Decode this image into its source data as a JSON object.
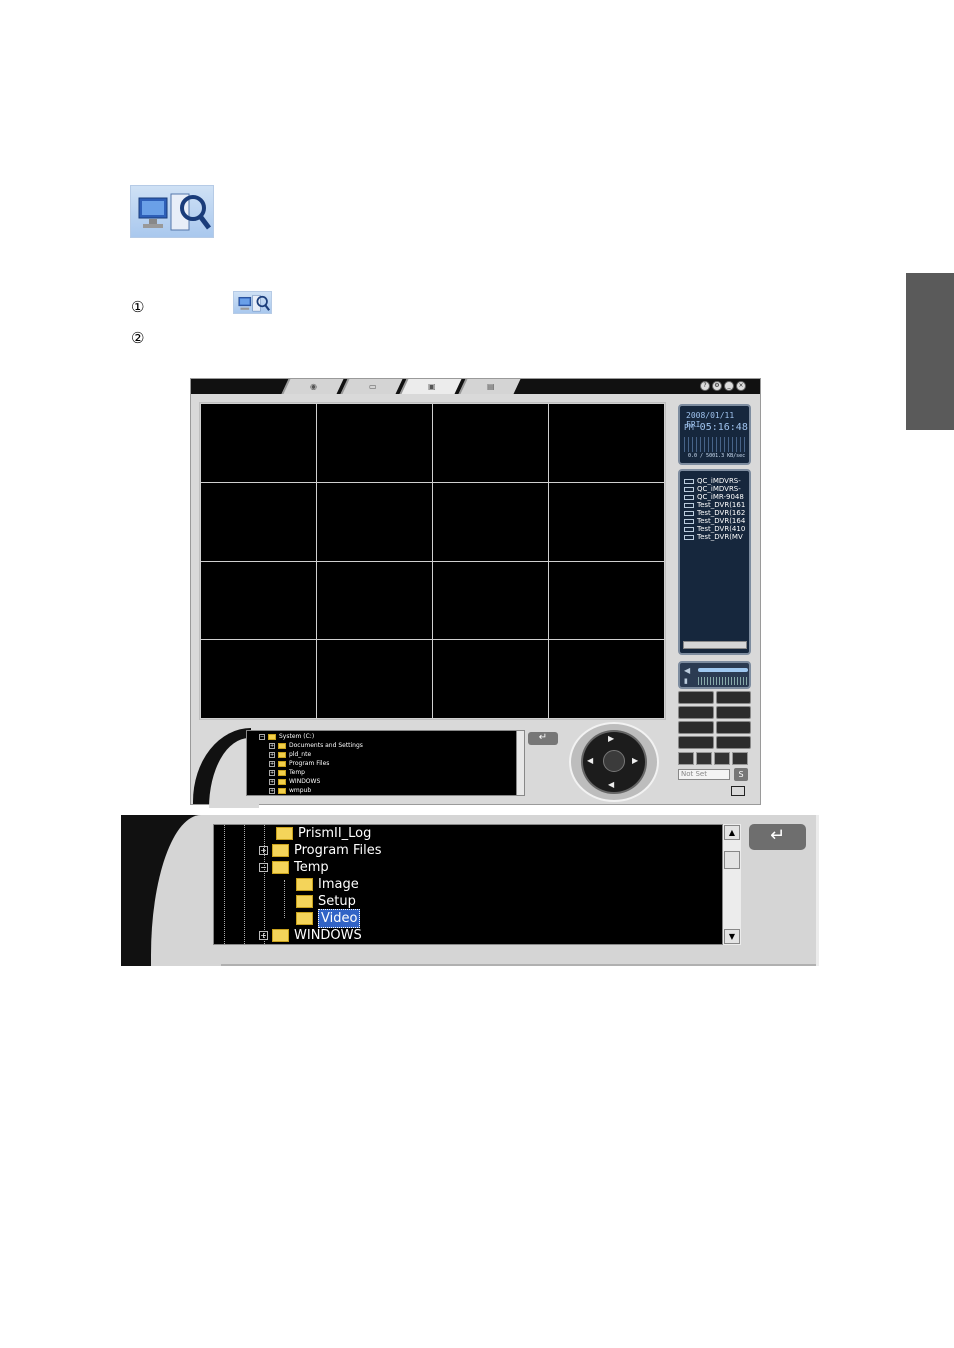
{
  "page": {
    "step_marks": [
      "①",
      "②"
    ]
  },
  "app": {
    "tabs": [
      {
        "name": "live-view-tab",
        "icon": "camera-icon"
      },
      {
        "name": "setup-tab",
        "icon": "keyboard-icon"
      },
      {
        "name": "search-tab",
        "icon": "monitor-search-icon",
        "active": true
      },
      {
        "name": "backup-tab",
        "icon": "recorder-icon"
      }
    ],
    "window_buttons": [
      "?",
      "⚙",
      "_",
      "×"
    ],
    "clock": {
      "date": "2008/01/11 FRI",
      "ampm": "PM",
      "time": "05:16:48",
      "rate": "0.0 / 5001.3 KB/sec"
    },
    "dvr_list": [
      "QC_iMDVRS-",
      "QC_iMDVRS-",
      "QC_iMR-9048",
      "Test_DVR(161",
      "Test_DVR(162",
      "Test_DVR(164",
      "Test_DVR(410",
      "Test_DVR(MV"
    ],
    "not_set_label": "Not Set",
    "s_button": "S",
    "enter_symbol": "↵",
    "small_tree": [
      {
        "label": "System (C:)",
        "level": 0,
        "expander": "−"
      },
      {
        "label": "Documents and Settings",
        "level": 1,
        "expander": "+"
      },
      {
        "label": "pld_nte",
        "level": 1,
        "expander": "+"
      },
      {
        "label": "Program Files",
        "level": 1,
        "expander": "+"
      },
      {
        "label": "Temp",
        "level": 1,
        "expander": "+"
      },
      {
        "label": "WINDOWS",
        "level": 1,
        "expander": "+"
      },
      {
        "label": "wmpub",
        "level": 1,
        "expander": "+"
      }
    ]
  },
  "zoom_tree": {
    "items": [
      {
        "label": "PrismII_Log",
        "level": 0,
        "expander": ""
      },
      {
        "label": "Program Files",
        "level": 0,
        "expander": "+"
      },
      {
        "label": "Temp",
        "level": 0,
        "expander": "−"
      },
      {
        "label": "Image",
        "level": 1,
        "expander": ""
      },
      {
        "label": "Setup",
        "level": 1,
        "expander": ""
      },
      {
        "label": "Video",
        "level": 1,
        "expander": "",
        "selected": true
      },
      {
        "label": "WINDOWS",
        "level": 0,
        "expander": "+"
      }
    ],
    "scroll_up": "▲",
    "scroll_down": "▼",
    "enter_symbol": "↵"
  }
}
